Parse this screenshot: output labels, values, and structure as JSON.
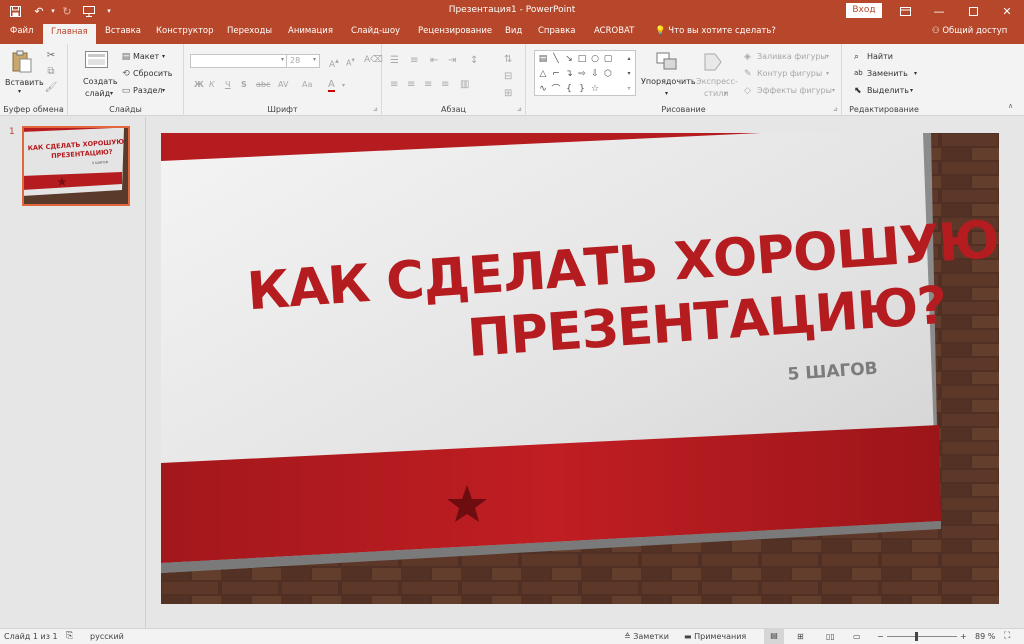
{
  "title_bar": {
    "window_title": "Презентация1  -  PowerPoint",
    "sign_in": "Вход"
  },
  "tabs": [
    {
      "label": "Файл"
    },
    {
      "label": "Главная"
    },
    {
      "label": "Вставка"
    },
    {
      "label": "Конструктор"
    },
    {
      "label": "Переходы"
    },
    {
      "label": "Анимация"
    },
    {
      "label": "Слайд-шоу"
    },
    {
      "label": "Рецензирование"
    },
    {
      "label": "Вид"
    },
    {
      "label": "Справка"
    },
    {
      "label": "ACROBAT"
    }
  ],
  "tell_me": "Что вы хотите сделать?",
  "share": "Общий доступ",
  "ribbon": {
    "clipboard": {
      "paste": "Вставить",
      "label": "Буфер обмена"
    },
    "slides": {
      "new_slide_1": "Создать",
      "new_slide_2": "слайд",
      "layout": "Макет",
      "reset": "Сбросить",
      "section": "Раздел",
      "label": "Слайды"
    },
    "font": {
      "size": "28",
      "label": "Шрифт",
      "bold": "Ж",
      "italic": "К",
      "underline": "Ч",
      "strike": "S",
      "shadow": "abc",
      "spacing": "AV",
      "case": "Aa",
      "color": "A"
    },
    "paragraph": {
      "label": "Абзац"
    },
    "drawing": {
      "arrange": "Упорядочить",
      "quick_styles_1": "Экспресс-",
      "quick_styles_2": "стили",
      "fill": "Заливка фигуры",
      "outline": "Контур фигуры",
      "effects": "Эффекты фигуры",
      "label": "Рисование"
    },
    "editing": {
      "find": "Найти",
      "replace": "Заменить",
      "select": "Выделить",
      "label": "Редактирование"
    }
  },
  "thumbnail": {
    "number": "1",
    "line1": "КАК СДЕЛАТЬ ХОРОШУЮ",
    "line2": "ПРЕЗЕНТАЦИЮ?",
    "sub": "5 ШАГОВ"
  },
  "slide": {
    "title_line1": "КАК СДЕЛАТЬ ХОРОШУЮ",
    "title_line2": "ПРЕЗЕНТАЦИЮ?",
    "subtitle": "5 ШАГОВ"
  },
  "status": {
    "slide_info": "Слайд 1 из 1",
    "language": "русский",
    "notes": "Заметки",
    "comments": "Примечания",
    "zoom": "89 %"
  },
  "colors": {
    "accent": "#b7472a",
    "slide_red": "#b51c20",
    "title_red": "#b51c20"
  }
}
